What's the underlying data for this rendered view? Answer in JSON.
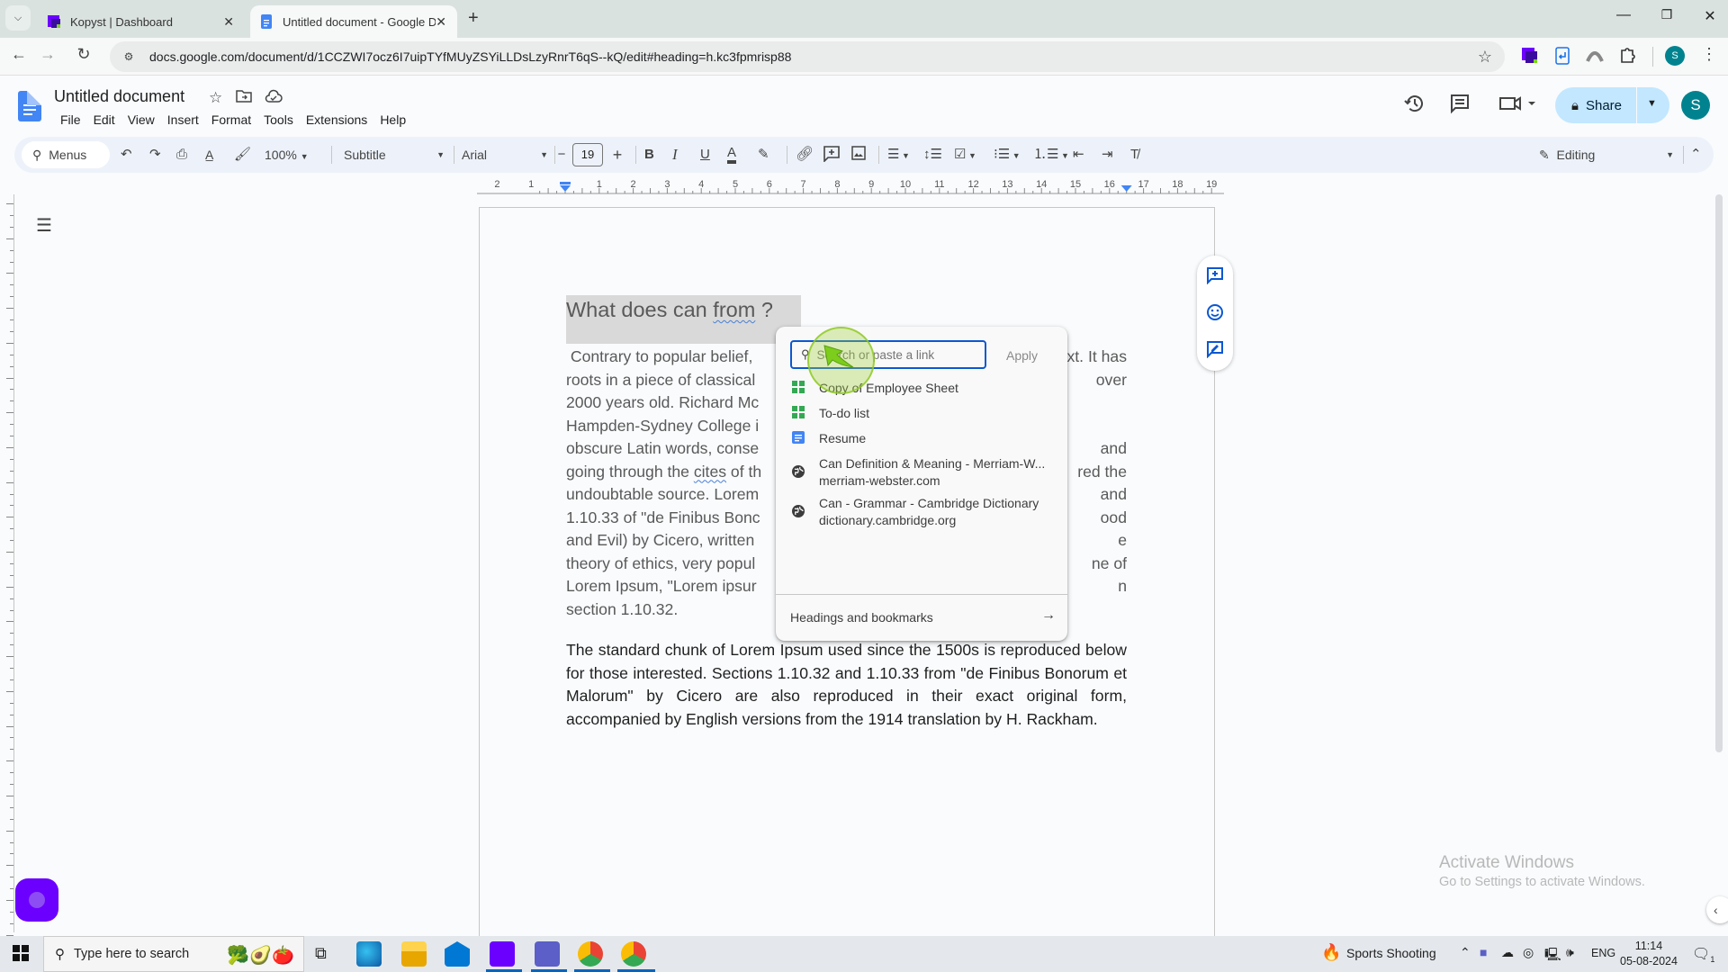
{
  "browser": {
    "tabs": [
      {
        "title": "Kopyst | Dashboard",
        "active": false
      },
      {
        "title": "Untitled document - Google Do",
        "active": true
      }
    ],
    "new_tab_icon": "plus-icon",
    "url": "docs.google.com/document/d/1CCZWI7ocz6I7uipTYfMUyZSYiLLDsLzyRnrT6qS--kQ/edit#heading=h.kc3fpmrisp88",
    "profile_initial": "S",
    "window_controls": [
      "minimize",
      "restore",
      "close"
    ]
  },
  "docs": {
    "title": "Untitled document",
    "menu": [
      "File",
      "Edit",
      "View",
      "Insert",
      "Format",
      "Tools",
      "Extensions",
      "Help"
    ],
    "share_label": "Share",
    "user_initial": "S",
    "toolbar": {
      "menus_label": "Menus",
      "zoom": "100%",
      "style": "Subtitle",
      "font": "Arial",
      "font_size": "19",
      "mode": "Editing"
    },
    "ruler_labels": [
      "2",
      "1",
      "1",
      "2",
      "3",
      "4",
      "5",
      "6",
      "7",
      "8",
      "9",
      "10",
      "11",
      "12",
      "13",
      "14",
      "15",
      "16",
      "17",
      "18",
      "19"
    ]
  },
  "document": {
    "heading_parts": [
      "What does can ",
      "from",
      " ?"
    ],
    "para1_lines": [
      " Contrary to popular belief,",
      "roots in a piece of classical",
      "2000 years old. Richard Mc",
      "Hampden-Sydney College i",
      "obscure Latin words, conse",
      "going through the |cites| of th",
      "undoubtable source. Lorem",
      "1.10.33 of \"de Finibus Bonc",
      "and Evil) by Cicero, written",
      "theory of ethics, very popul",
      "Lorem Ipsum, \"Lorem ipsur",
      "section 1.10.32."
    ],
    "para1_right_fragments": [
      "xt. It has",
      "over",
      "",
      "",
      "and",
      "red the",
      "and",
      "ood",
      "e",
      "ne of",
      "n",
      ""
    ],
    "para2": "The standard chunk of Lorem Ipsum used since the 1500s is reproduced below for those interested. Sections 1.10.32 and 1.10.33 from \"de Finibus Bonorum et Malorum\" by Cicero are also reproduced in their exact original form, accompanied by English versions from the 1914 translation by H. Rackham."
  },
  "link_popup": {
    "placeholder": "Search or paste a link",
    "apply_label": "Apply",
    "suggestions": [
      {
        "icon": "sheets-icon",
        "title": "Copy of Employee Sheet",
        "subtitle": ""
      },
      {
        "icon": "sheets-icon",
        "title": "To-do list",
        "subtitle": ""
      },
      {
        "icon": "docs-icon",
        "title": "Resume",
        "subtitle": ""
      },
      {
        "icon": "globe-icon",
        "title": "Can Definition & Meaning - Merriam-W...",
        "subtitle": "merriam-webster.com"
      },
      {
        "icon": "globe-icon",
        "title": "Can - Grammar - Cambridge Dictionary",
        "subtitle": "dictionary.cambridge.org"
      }
    ],
    "footer_label": "Headings and bookmarks"
  },
  "watermark": {
    "title": "Activate Windows",
    "subtitle": "Go to Settings to activate Windows."
  },
  "taskbar": {
    "search_placeholder": "Type here to search",
    "news": "Sports Shooting",
    "language": "ENG",
    "time": "11:14",
    "date": "05-08-2024",
    "notifications": "1"
  },
  "colors": {
    "accent": "#0b57d0",
    "share_bg": "#c2e7ff",
    "avatar": "#00838f",
    "kopyst": "#6c00ff"
  }
}
